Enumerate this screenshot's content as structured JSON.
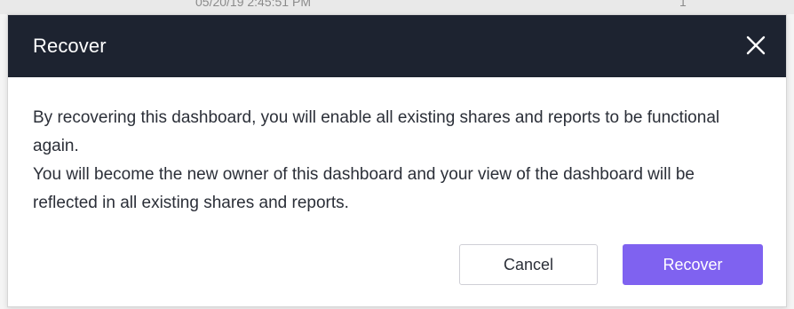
{
  "background_row": {
    "timestamp": "05/20/19 2:45:51 PM",
    "count": "1"
  },
  "dialog": {
    "title": "Recover",
    "close_icon": "close-icon",
    "message_line1": "By recovering this dashboard, you will enable all existing shares and reports to be functional again.",
    "message_line2": "You will become the new owner of this dashboard and your view of the dashboard will be reflected in all existing shares and reports.",
    "cancel_label": "Cancel",
    "confirm_label": "Recover"
  },
  "colors": {
    "header_bg": "#1d2330",
    "primary_button": "#7f62f0",
    "text": "#2b2f38"
  }
}
